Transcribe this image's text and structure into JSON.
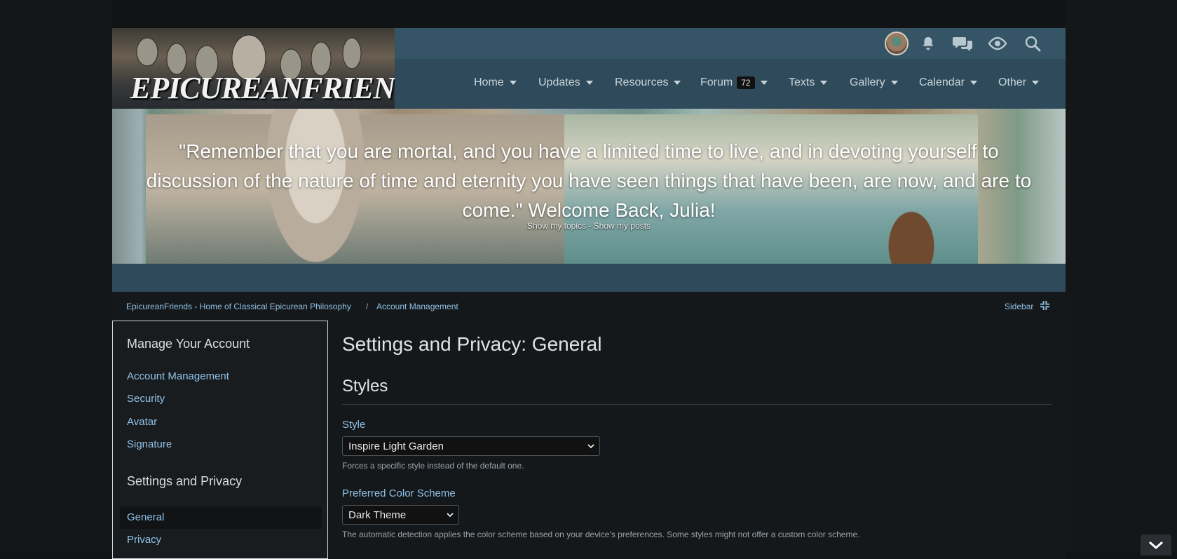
{
  "header": {
    "logo_text": "EPICUREANFRIENDS.COM",
    "icons": [
      "avatar",
      "bell-icon",
      "chat-icon",
      "eye-icon",
      "search-icon"
    ]
  },
  "nav": {
    "items": [
      {
        "label": "Home"
      },
      {
        "label": "Updates"
      },
      {
        "label": "Resources"
      },
      {
        "label": "Forum",
        "badge": "72"
      },
      {
        "label": "Texts"
      },
      {
        "label": "Gallery"
      },
      {
        "label": "Calendar"
      },
      {
        "label": "Other"
      }
    ]
  },
  "banner": {
    "quote": "\"Remember that you are mortal, and you have a limited time to live, and in devoting yourself to discussion of the nature of time and eternity you have seen things that have been, are now, and are to come.\" Welcome Back, Julia!",
    "links": "Show my topics - Show my posts"
  },
  "breadcrumb": {
    "home": "EpicureanFriends - Home of Classical Epicurean Philosophy",
    "separator": "/",
    "current": "Account Management",
    "sidebar_toggle": "Sidebar"
  },
  "sidebar": {
    "section1_title": "Manage Your Account",
    "section1_items": [
      "Account Management",
      "Security",
      "Avatar",
      "Signature"
    ],
    "section2_title": "Settings and Privacy",
    "section2_items": [
      "General",
      "Privacy"
    ]
  },
  "main": {
    "title": "Settings and Privacy: General",
    "section_title": "Styles",
    "style_label": "Style",
    "style_value": "Inspire Light Garden",
    "style_hint": "Forces a specific style instead of the default one.",
    "scheme_label": "Preferred Color Scheme",
    "scheme_value": "Dark Theme",
    "scheme_hint": "The automatic detection applies the color scheme based on your device's preferences. Some styles might not offer a custom color scheme."
  },
  "colors": {
    "header_bg": "#2f4b5b",
    "topbar_bg": "#355566",
    "link": "#8fc1e6",
    "page_bg": "#111315"
  }
}
